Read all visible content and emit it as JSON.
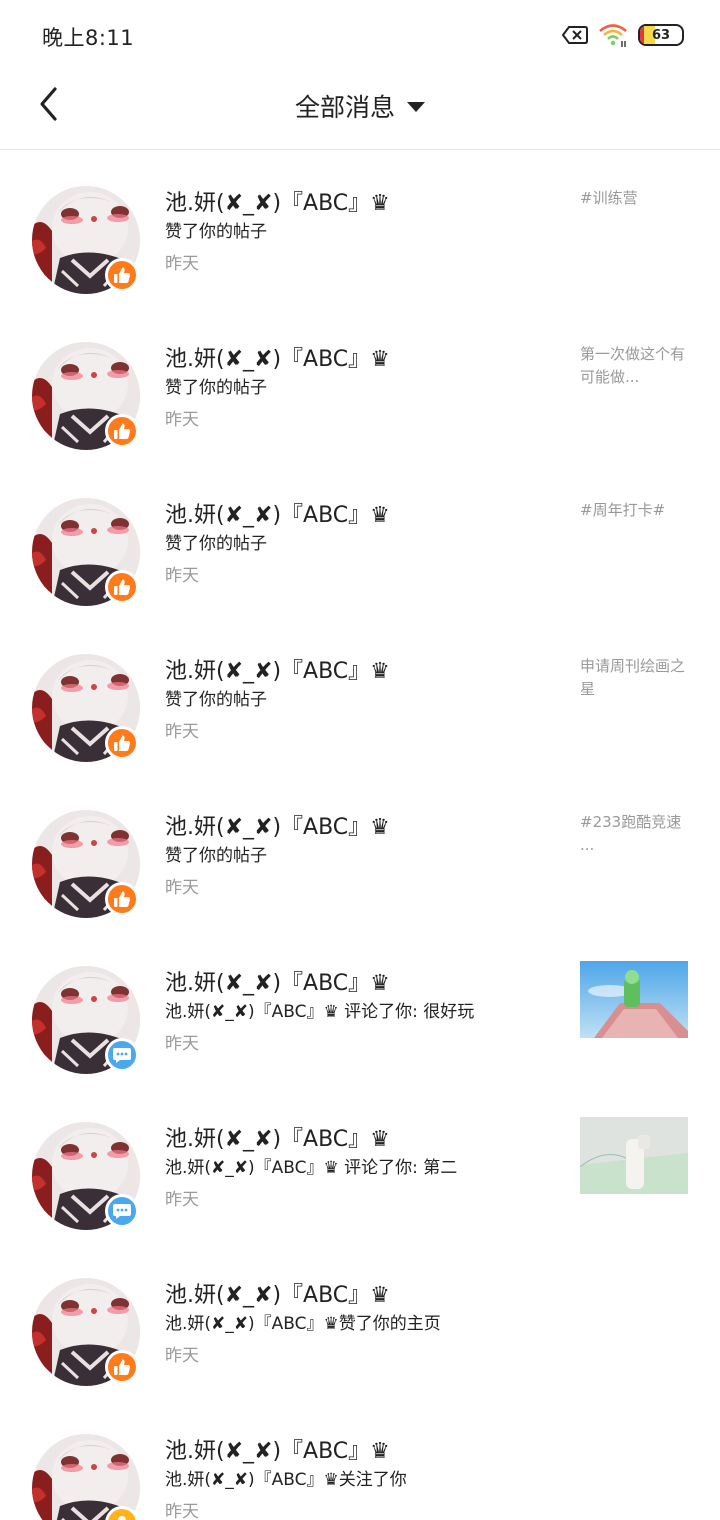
{
  "status_bar": {
    "time": "晚上8:11",
    "battery_level": "63"
  },
  "header": {
    "title": "全部消息",
    "back_icon": "chevron-left-icon",
    "dropdown_icon": "caret-down-icon"
  },
  "colors": {
    "like_badge": "#ff7a1a",
    "comment_badge": "#4aa8f0",
    "follow_badge": "#ffb21a",
    "secondary_text": "#999999"
  },
  "notifications": [
    {
      "user": "池.妍(✘_✘)『ABC』♛",
      "action": "赞了你的帖子",
      "time": "昨天",
      "badge": "like",
      "ref_text": "#训练营"
    },
    {
      "user": "池.妍(✘_✘)『ABC』♛",
      "action": "赞了你的帖子",
      "time": "昨天",
      "badge": "like",
      "ref_text": "第一次做这个有可能做..."
    },
    {
      "user": "池.妍(✘_✘)『ABC』♛",
      "action": "赞了你的帖子",
      "time": "昨天",
      "badge": "like",
      "ref_text": "#周年打卡#"
    },
    {
      "user": "池.妍(✘_✘)『ABC』♛",
      "action": "赞了你的帖子",
      "time": "昨天",
      "badge": "like",
      "ref_text": "申请周刊绘画之星"
    },
    {
      "user": "池.妍(✘_✘)『ABC』♛",
      "action": "赞了你的帖子",
      "time": "昨天",
      "badge": "like",
      "ref_text": "#233跑酷竞速 ..."
    },
    {
      "user": "池.妍(✘_✘)『ABC』♛",
      "action": "池.妍(✘_✘)『ABC』♛ 评论了你: 很好玩",
      "time": "昨天",
      "badge": "comment",
      "ref_image": "game-screenshot-blue-sky"
    },
    {
      "user": "池.妍(✘_✘)『ABC』♛",
      "action": "池.妍(✘_✘)『ABC』♛ 评论了你: 第二",
      "time": "昨天",
      "badge": "comment",
      "ref_image": "game-screenshot-pale-room"
    },
    {
      "user": "池.妍(✘_✘)『ABC』♛",
      "action": "池.妍(✘_✘)『ABC』♛赞了你的主页",
      "time": "昨天",
      "badge": "like"
    },
    {
      "user": "池.妍(✘_✘)『ABC』♛",
      "action": "池.妍(✘_✘)『ABC』♛关注了你",
      "time": "昨天",
      "badge": "follow"
    }
  ]
}
